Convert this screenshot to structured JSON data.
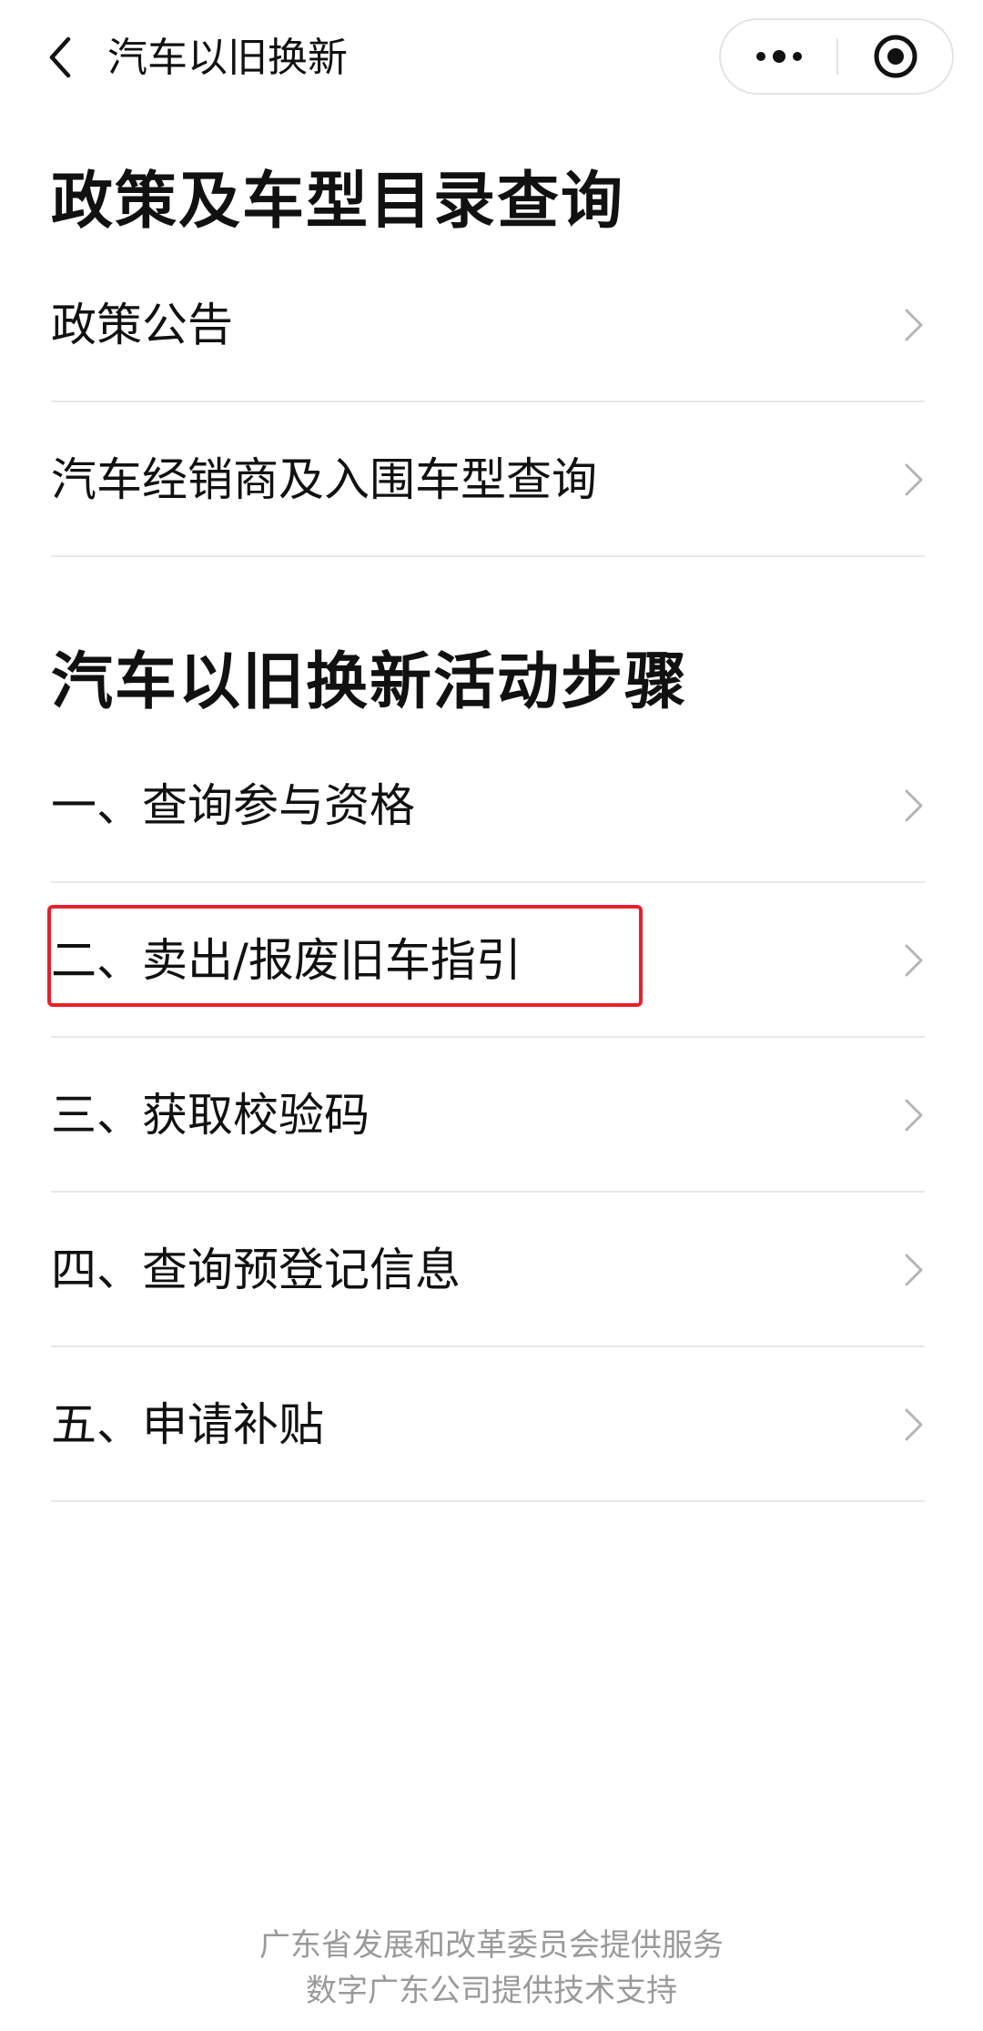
{
  "header": {
    "title": "汽车以旧换新",
    "back_icon": "chevron-left-icon",
    "more_icon": "more-dots-icon",
    "close_icon": "target-close-icon"
  },
  "sections": [
    {
      "title": "政策及车型目录查询",
      "items": [
        {
          "label": "政策公告"
        },
        {
          "label": "汽车经销商及入围车型查询"
        }
      ]
    },
    {
      "title": "汽车以旧换新活动步骤",
      "items": [
        {
          "label": "一、查询参与资格"
        },
        {
          "label": "二、卖出/报废旧车指引"
        },
        {
          "label": "三、获取校验码"
        },
        {
          "label": "四、查询预登记信息"
        },
        {
          "label": "五、申请补贴"
        }
      ]
    }
  ],
  "footer": {
    "line1": "广东省发展和改革委员会提供服务",
    "line2": "数字广东公司提供技术支持"
  },
  "colors": {
    "highlight": "#e8202a",
    "divider": "#e8e8e8",
    "footer_text": "#9a9a9a"
  }
}
